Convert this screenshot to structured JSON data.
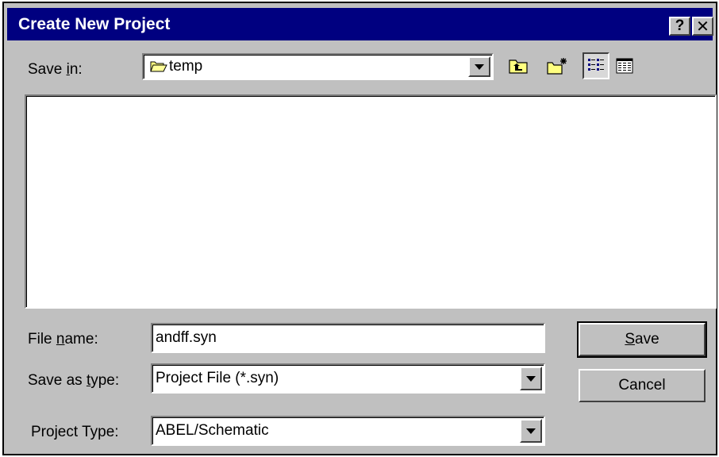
{
  "window": {
    "title": "Create New Project",
    "help_label": "?",
    "close_label": "✕"
  },
  "save_in": {
    "label_prefix": "Save ",
    "label_access": "i",
    "label_suffix": "n:",
    "value": "temp"
  },
  "toolbar": {
    "icons": [
      "up-one-level-icon",
      "create-new-folder-icon",
      "list-view-icon",
      "details-view-icon"
    ]
  },
  "file_name": {
    "label_prefix": "File ",
    "label_access": "n",
    "label_suffix": "ame:",
    "value": "andff.syn"
  },
  "save_as_type": {
    "label_prefix": "Save as ",
    "label_access": "t",
    "label_suffix": "ype:",
    "value": "Project File (*.syn)"
  },
  "project_type": {
    "label": "Project Type:",
    "value": "ABEL/Schematic"
  },
  "buttons": {
    "save_access": "S",
    "save_rest": "ave",
    "cancel": "Cancel"
  },
  "colors": {
    "titlebar": "#000080",
    "face": "#c0c0c0",
    "folder": "#ffff80"
  }
}
